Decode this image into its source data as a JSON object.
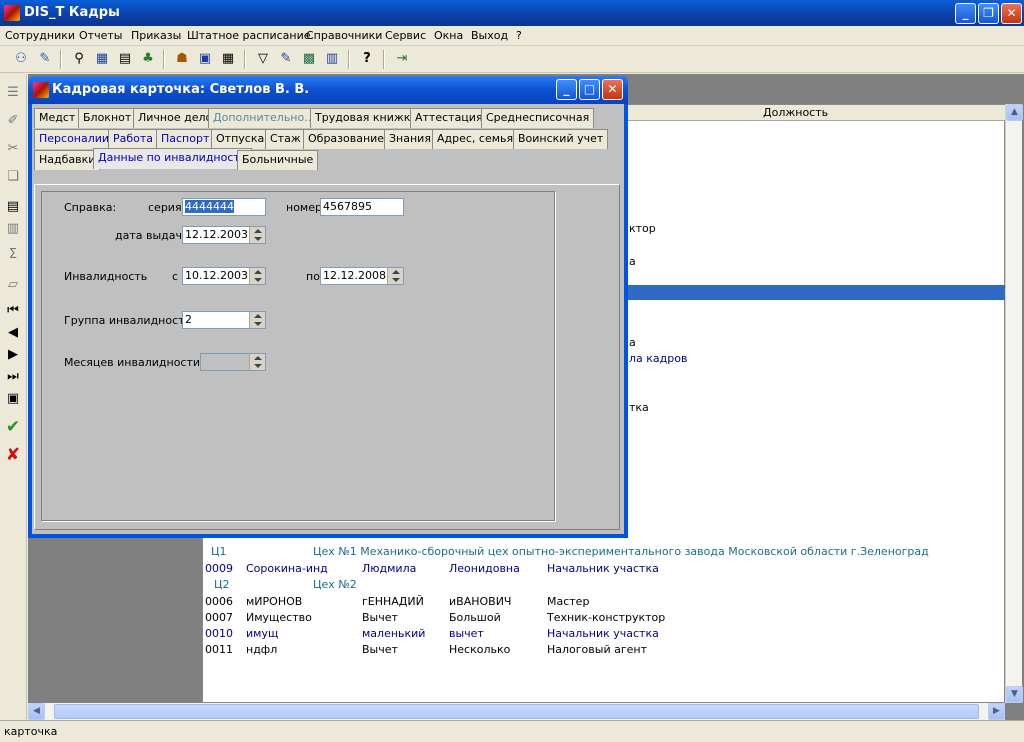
{
  "app": {
    "title": "DIS_Т Кадры"
  },
  "menu": [
    "Сотрудники",
    "Отчеты",
    "Приказы",
    "Штатное расписание",
    "Справочники",
    "Сервис",
    "Окна",
    "Выход",
    "?"
  ],
  "grid": {
    "column_header": "Должность",
    "fragments": [
      "ктор",
      "а",
      "а",
      "ла кадров",
      "тка"
    ],
    "rows": [
      {
        "code": "Ц1",
        "last": "",
        "first": "",
        "middle": "Цех №1 Механико-сборочный цех опытно-экспериментального завода Московской области г.Зеленоград",
        "position": "",
        "style": "teal"
      },
      {
        "code": "0009",
        "last": "Сорокина-инд",
        "first": "Людмила",
        "middle": "Леонидовна",
        "position": "Начальник участка",
        "style": "blue"
      },
      {
        "code": "Ц2",
        "last": "",
        "first": "",
        "middle": "Цех №2",
        "position": "",
        "style": "teal"
      },
      {
        "code": "0006",
        "last": "мИРОНОВ",
        "first": "гЕННАДИЙ",
        "middle": "иВАНОВИЧ",
        "position": "Мастер",
        "style": ""
      },
      {
        "code": "0007",
        "last": "Имущество",
        "first": "Вычет",
        "middle": "Большой",
        "position": "Техник-конструктор",
        "style": ""
      },
      {
        "code": "0010",
        "last": "имущ",
        "first": "маленький",
        "middle": "вычет",
        "position": "Начальник участка",
        "style": "blue"
      },
      {
        "code": "0011",
        "last": "ндфл",
        "first": "Вычет",
        "middle": "Несколько",
        "position": "Налоговый агент",
        "style": ""
      }
    ]
  },
  "status": {
    "text": "карточка"
  },
  "dialog": {
    "title": "Кадровая карточка: Светлов В. В.",
    "tabs_row1": [
      "Медст",
      "Блокнот",
      "Личное дело",
      "Дополнительно...",
      "Трудовая книжка",
      "Аттестация",
      "Среднесписочная"
    ],
    "tabs_row2": [
      "Персоналии",
      "Работа",
      "Паспорт",
      "Отпуска",
      "Стаж",
      "Образование",
      "Знания",
      "Адрес, семья",
      "Воинский учет"
    ],
    "tabs_row3": [
      "Надбавки",
      "Данные по инвалидности",
      "Больничные"
    ],
    "form": {
      "certificate_label": "Справка:",
      "series_label": "серия",
      "series_value": "4444444",
      "number_label": "номер",
      "number_value": "4567895",
      "issue_date_label": "дата выдачи",
      "issue_date_value": "12.12.2003",
      "disability_label": "Инвалидность",
      "from_label": "с",
      "from_value": "10.12.2003",
      "to_label": "по",
      "to_value": "12.12.2008",
      "group_label": "Группа инвалидности",
      "group_value": "2",
      "months_label": "Месяцев инвалидности",
      "months_value": ""
    }
  }
}
